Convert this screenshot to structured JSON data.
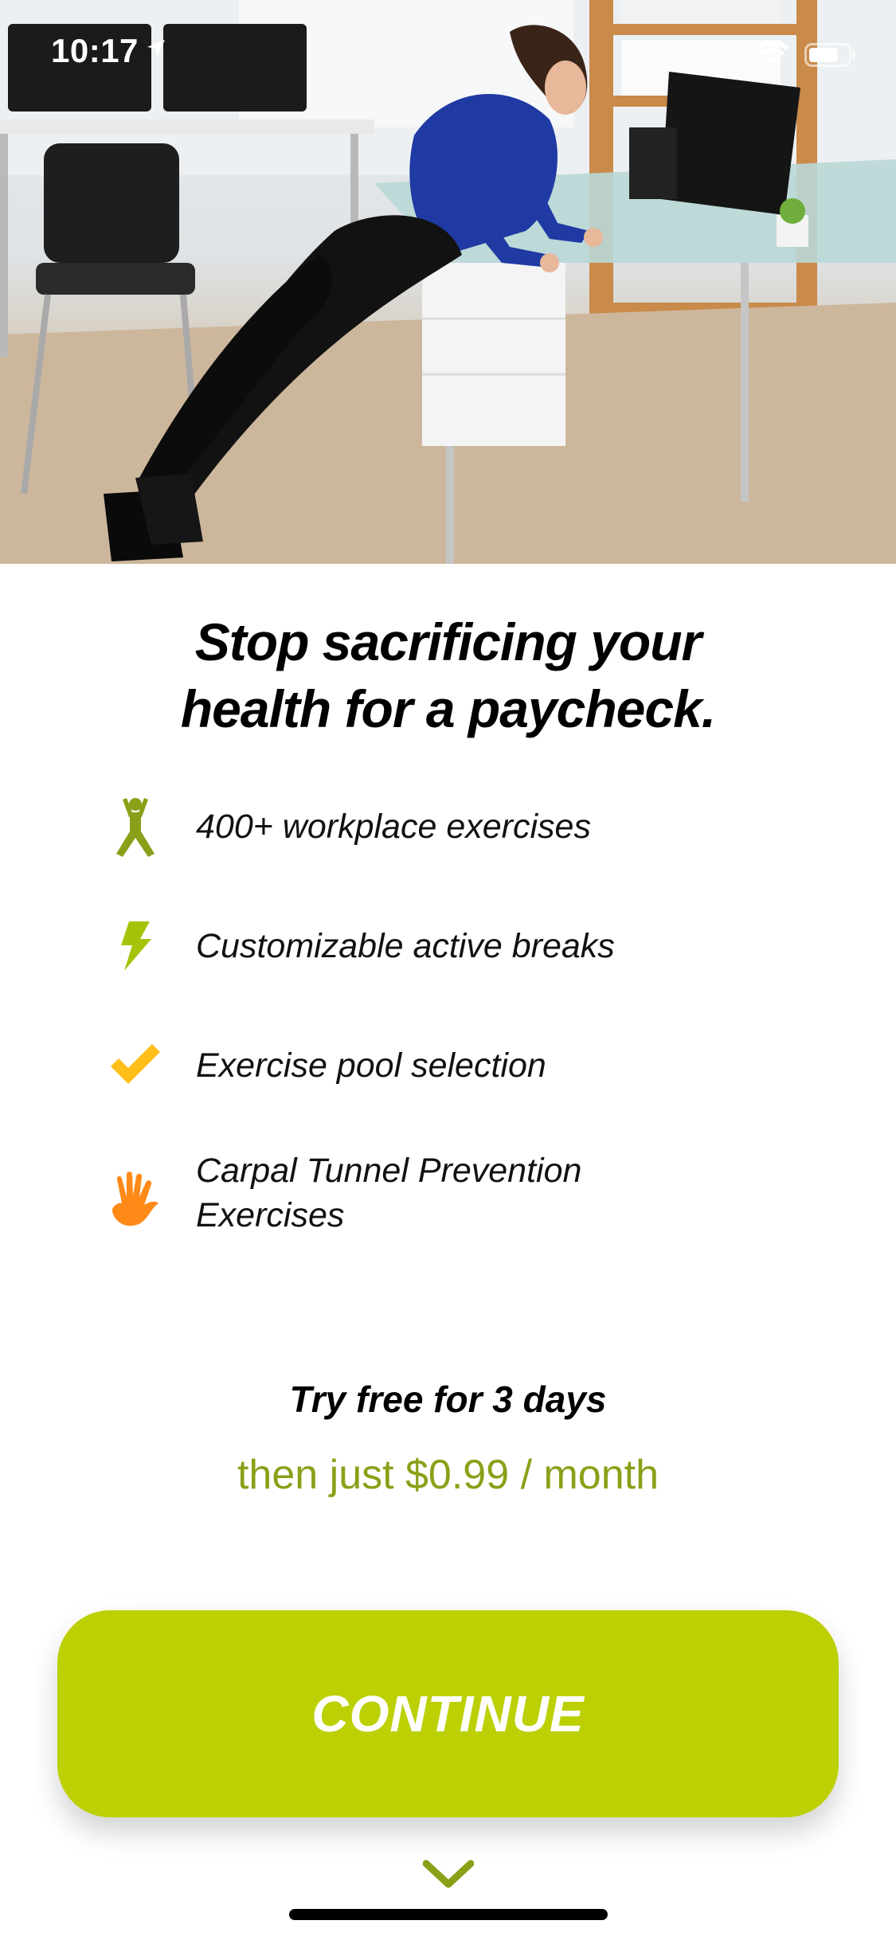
{
  "status_bar": {
    "time": "10:17",
    "location_icon": "location-arrow-icon",
    "wifi_icon": "wifi-icon",
    "battery_icon": "battery-icon"
  },
  "hero": {
    "image": "woman-doing-desk-pushups-photo"
  },
  "headline": {
    "line1": "Stop sacrificing your",
    "line2": "health for a paycheck."
  },
  "features": [
    {
      "icon": "person-exercise-icon",
      "icon_color": "#8aa018",
      "label": "400+ workplace exercises"
    },
    {
      "icon": "lightning-bolt-icon",
      "icon_color": "#a6c30a",
      "label": "Customizable active breaks"
    },
    {
      "icon": "checkmark-icon",
      "icon_color": "#ffbe1a",
      "label": "Exercise pool selection"
    },
    {
      "icon": "hand-icon",
      "icon_color": "#ff8a17",
      "label": "Carpal Tunnel Prevention Exercises"
    }
  ],
  "offer": {
    "trial": "Try free for 3 days",
    "price": "then just $0.99 / month"
  },
  "cta": {
    "label": "CONTINUE",
    "color": "#bcd004"
  },
  "scroll_hint_icon": "chevron-down-icon",
  "colors": {
    "accent": "#bcd004",
    "price_text": "#8aa018"
  }
}
